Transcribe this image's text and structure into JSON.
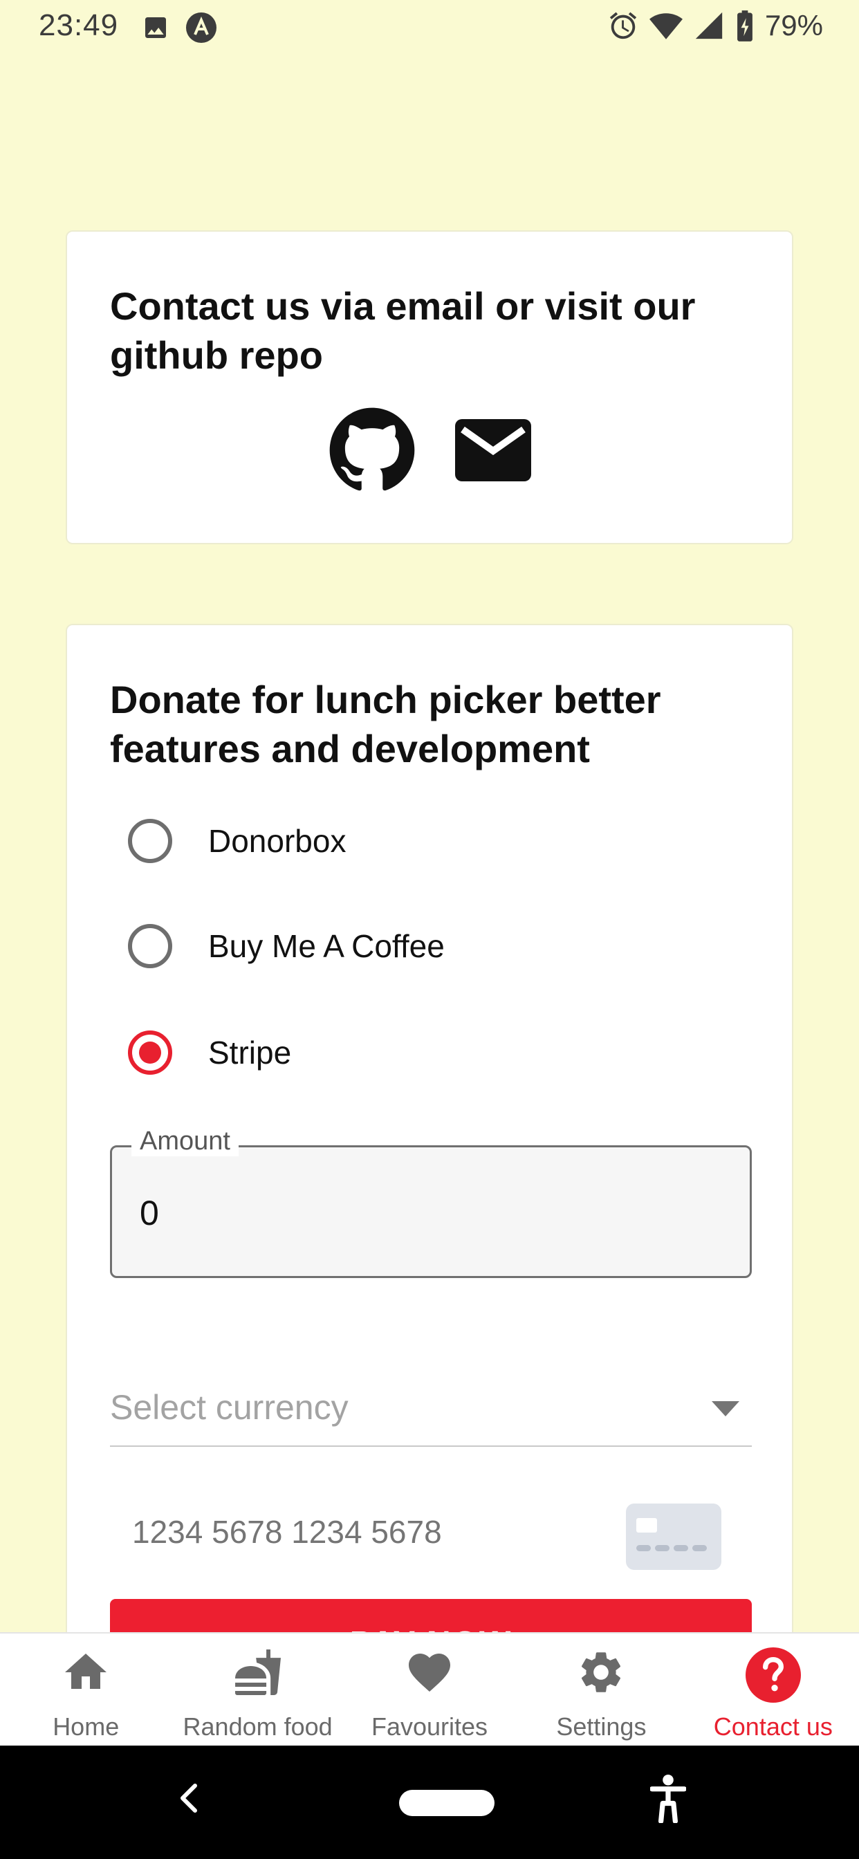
{
  "status_bar": {
    "time": "23:49",
    "battery_percent": "79%",
    "icons": [
      "image-icon",
      "app-icon",
      "alarm-icon",
      "wifi-icon",
      "signal-icon",
      "battery-charging-icon"
    ]
  },
  "contact_card": {
    "title": "Contact us via email or visit our github repo",
    "icons": [
      "github-icon",
      "email-icon"
    ]
  },
  "donate_card": {
    "title": "Donate for lunch picker better features and development",
    "options": [
      {
        "label": "Donorbox",
        "checked": false
      },
      {
        "label": "Buy Me A Coffee",
        "checked": false
      },
      {
        "label": "Stripe",
        "checked": true
      }
    ],
    "amount": {
      "label": "Amount",
      "value": "0"
    },
    "currency": {
      "placeholder": "Select currency"
    },
    "card_number": {
      "placeholder": "1234 5678 1234 5678"
    },
    "pay_button": {
      "label": "PAY NOW"
    }
  },
  "bottom_nav": {
    "items": [
      {
        "label": "Home",
        "icon": "home-icon",
        "active": false
      },
      {
        "label": "Random food",
        "icon": "fastfood-icon",
        "active": false
      },
      {
        "label": "Favourites",
        "icon": "heart-icon",
        "active": false
      },
      {
        "label": "Settings",
        "icon": "gear-icon",
        "active": false
      },
      {
        "label": "Contact us",
        "icon": "help-icon",
        "active": true
      }
    ]
  },
  "colors": {
    "background": "#fafad2",
    "accent": "#e8202f",
    "inactive": "#6a6a6a"
  }
}
